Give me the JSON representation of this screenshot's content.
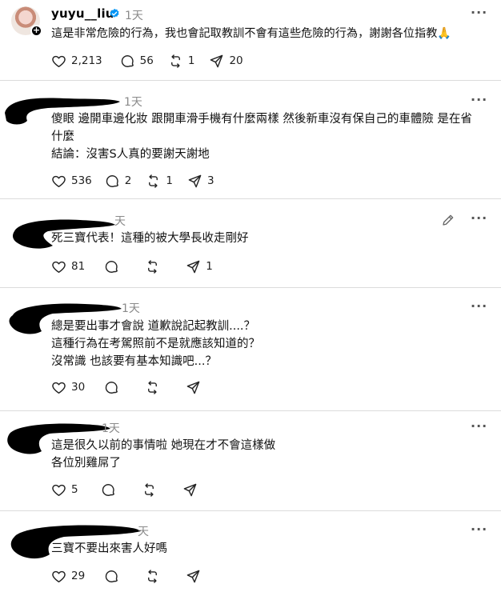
{
  "main_post": {
    "username": "yuyu__liu",
    "time": "1天",
    "text": "這是非常危險的行為，我也會記取教訓不會有這些危險的行為，謝謝各位指教🙏",
    "likes": "2,213",
    "comments": "56",
    "reposts": "1",
    "shares": "20"
  },
  "replies": [
    {
      "time": "1天",
      "lines": [
        "傻眼 邊開車邊化妝 跟開車滑手機有什麼兩樣 然後新車沒有保自己的車體險 是在省",
        "什麼",
        "結論：沒害S人真的要謝天謝地"
      ],
      "likes": "536",
      "comments": "2",
      "reposts": "1",
      "shares": "3"
    },
    {
      "time": "天",
      "lines": [
        "死三寶代表！這種的被大學長收走剛好"
      ],
      "likes": "81",
      "comments": "",
      "reposts": "",
      "shares": "1"
    },
    {
      "time": "1天",
      "lines": [
        "總是要出事才會說 道歉說記起教訓....？",
        "這種行為在考駕照前不是就應該知道的？",
        "沒常識 也該要有基本知識吧...？"
      ],
      "likes": "30",
      "comments": "",
      "reposts": "",
      "shares": ""
    },
    {
      "time": "1天",
      "lines": [
        "這是很久以前的事情啦 她現在才不會這樣做",
        "各位別雞屌了"
      ],
      "likes": "5",
      "comments": "",
      "reposts": "",
      "shares": ""
    },
    {
      "time": "天",
      "lines": [
        "三寶不要出來害人好嗎"
      ],
      "likes": "29",
      "comments": "",
      "reposts": "",
      "shares": ""
    }
  ],
  "more_glyph": "···"
}
